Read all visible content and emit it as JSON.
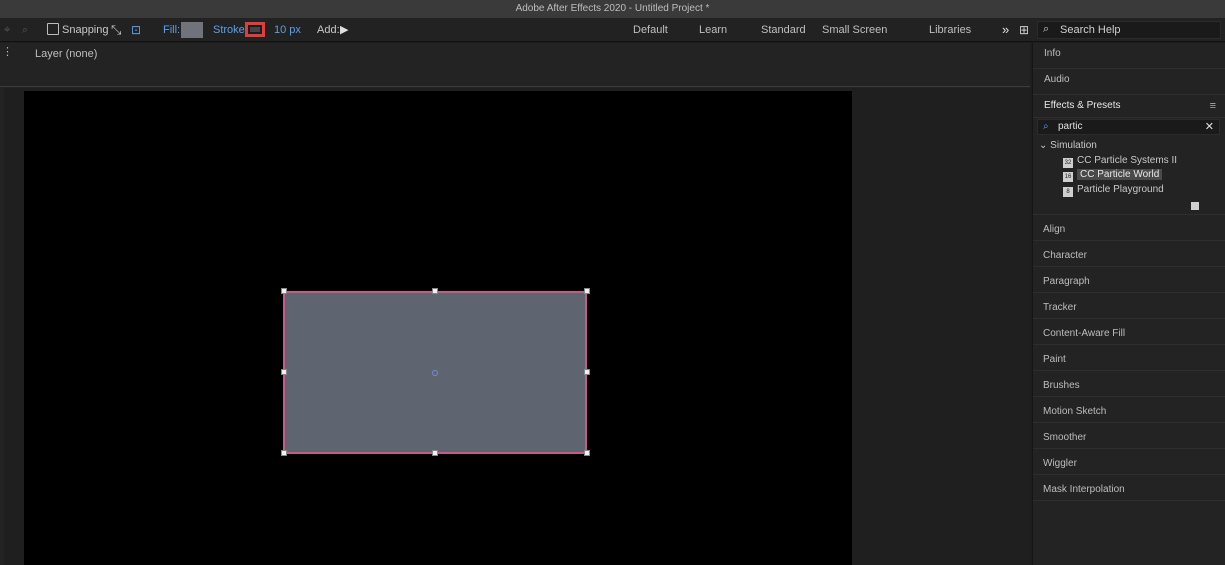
{
  "window": {
    "title": "Adobe After Effects 2020 - Untitled Project *"
  },
  "toolbar": {
    "snapping_label": "Snapping",
    "fill_label": "Fill:",
    "stroke_label": "Stroke:",
    "stroke_width": "10 px",
    "add_label": "Add:",
    "fill_color": "#70747a",
    "stroke_color": "#e23c3c"
  },
  "workspaces": {
    "tabs": [
      "Default",
      "Learn",
      "Standard",
      "Small Screen",
      "Libraries"
    ],
    "overflow": "»"
  },
  "search_help": {
    "placeholder": "Search Help"
  },
  "layer_panel": {
    "label": "Layer (none)"
  },
  "composition": {
    "shape_fill": "#5e6570",
    "shape_stroke": "#c85a86"
  },
  "right_panel": {
    "items_top": [
      "Info",
      "Audio",
      "Effects & Presets"
    ],
    "effects": {
      "search_value": "partic",
      "category": "Simulation",
      "results": [
        {
          "label": "CC Particle Systems II",
          "badge": "32"
        },
        {
          "label": "CC Particle World",
          "badge": "16",
          "selected": true
        },
        {
          "label": "Particle Playground",
          "badge": "8"
        }
      ]
    },
    "items_bottom": [
      "Align",
      "Character",
      "Paragraph",
      "Tracker",
      "Content-Aware Fill",
      "Paint",
      "Brushes",
      "Motion Sketch",
      "Smoother",
      "Wiggler",
      "Mask Interpolation"
    ]
  }
}
